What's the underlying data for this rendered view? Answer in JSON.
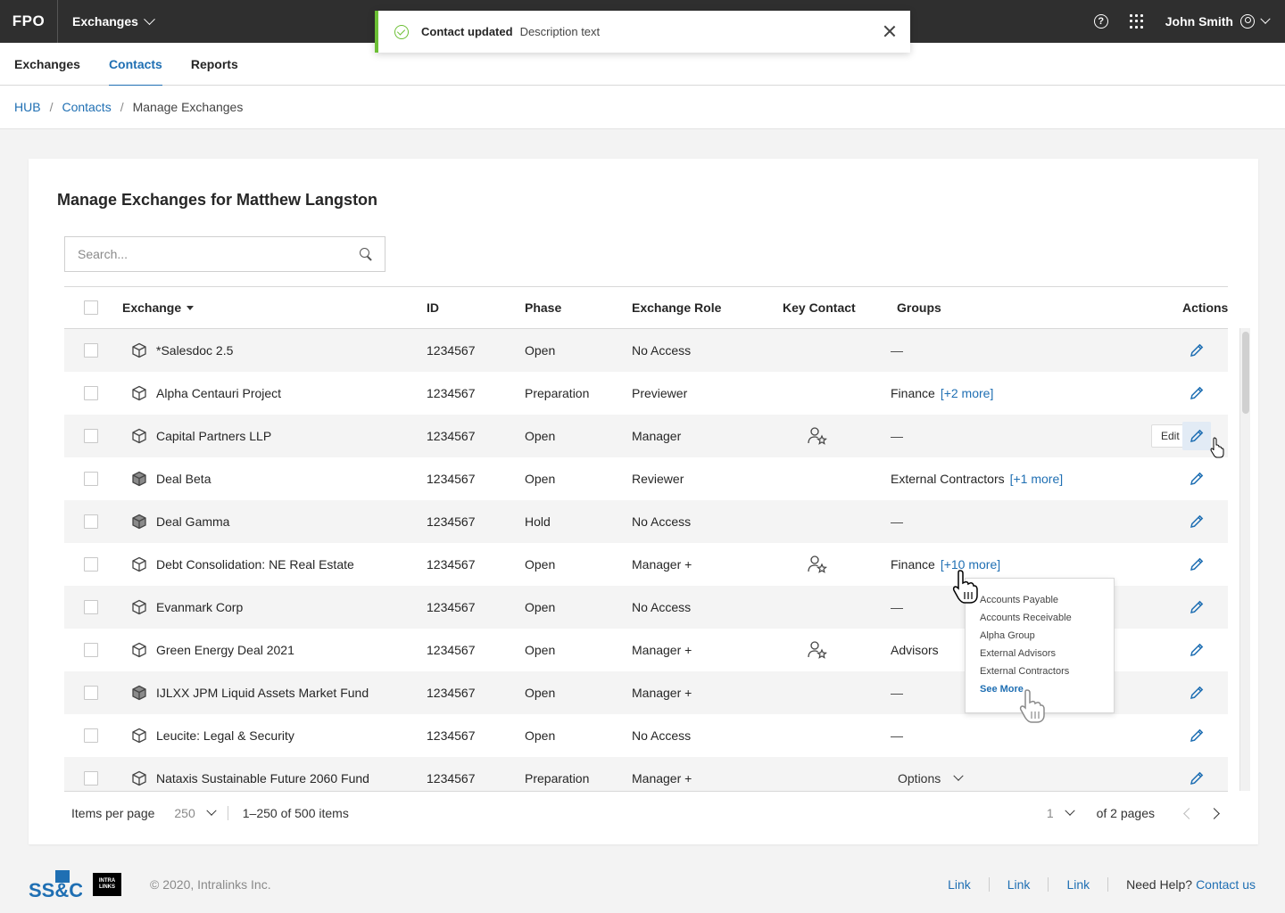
{
  "header": {
    "logo": "FPO",
    "app_switch": "Exchanges",
    "user_name": "John Smith",
    "help_glyph": "?"
  },
  "tabs": [
    {
      "label": "Exchanges",
      "active": false
    },
    {
      "label": "Contacts",
      "active": true
    },
    {
      "label": "Reports",
      "active": false
    }
  ],
  "breadcrumb": {
    "items": [
      "HUB",
      "Contacts"
    ],
    "current": "Manage Exchanges",
    "separator": "/"
  },
  "toast": {
    "title": "Contact updated",
    "description": "Description text",
    "status_color": "#6cbf35"
  },
  "page": {
    "title": "Manage Exchanges for Matthew Langston",
    "search_placeholder": "Search..."
  },
  "table": {
    "columns": {
      "exchange": "Exchange",
      "id": "ID",
      "phase": "Phase",
      "role": "Exchange Role",
      "key_contact": "Key Contact",
      "groups": "Groups",
      "actions": "Actions"
    },
    "rows": [
      {
        "name": "*Salesdoc 2.5",
        "icon": "box-outline-icon",
        "id": "1234567",
        "phase": "Open",
        "role": "No Access",
        "key_contact": false,
        "group": "—",
        "more": ""
      },
      {
        "name": "Alpha Centauri Project",
        "icon": "box-outline-icon",
        "id": "1234567",
        "phase": "Preparation",
        "role": "Previewer",
        "key_contact": false,
        "group": "Finance",
        "more": "[+2 more]"
      },
      {
        "name": "Capital Partners LLP",
        "icon": "box-outline-icon",
        "id": "1234567",
        "phase": "Open",
        "role": "Manager",
        "key_contact": true,
        "group": "—",
        "more": ""
      },
      {
        "name": "Deal Beta",
        "icon": "box-filled-icon",
        "id": "1234567",
        "phase": "Open",
        "role": "Reviewer",
        "key_contact": false,
        "group": "External Contractors",
        "more": "[+1 more]"
      },
      {
        "name": "Deal Gamma",
        "icon": "box-filled-icon",
        "id": "1234567",
        "phase": "Hold",
        "role": "No Access",
        "key_contact": false,
        "group": "—",
        "more": ""
      },
      {
        "name": "Debt Consolidation: NE Real Estate",
        "icon": "box-outline-icon",
        "id": "1234567",
        "phase": "Open",
        "role": "Manager +",
        "key_contact": true,
        "group": "Finance",
        "more": "[+10 more]"
      },
      {
        "name": "Evanmark Corp",
        "icon": "box-outline-icon",
        "id": "1234567",
        "phase": "Open",
        "role": "No Access",
        "key_contact": false,
        "group": "—",
        "more": ""
      },
      {
        "name": "Green Energy Deal 2021",
        "icon": "box-outline-icon",
        "id": "1234567",
        "phase": "Open",
        "role": "Manager +",
        "key_contact": true,
        "group": "Advisors",
        "more": ""
      },
      {
        "name": "IJLXX JPM Liquid Assets Market Fund",
        "icon": "box-filled-icon",
        "id": "1234567",
        "phase": "Open",
        "role": "Manager +",
        "key_contact": false,
        "group": "—",
        "more": ""
      },
      {
        "name": "Leucite: Legal & Security",
        "icon": "box-outline-icon",
        "id": "1234567",
        "phase": "Open",
        "role": "No Access",
        "key_contact": false,
        "group": "—",
        "more": ""
      },
      {
        "name": "Nataxis Sustainable Future 2060 Fund",
        "icon": "box-outline-icon",
        "id": "1234567",
        "phase": "Preparation",
        "role": "Manager +",
        "key_contact": false,
        "group": "",
        "more": "",
        "options": "Options"
      }
    ],
    "edit_tooltip": "Edit"
  },
  "groups_popover": {
    "items": [
      "Accounts Payable",
      "Accounts Receivable",
      "Alpha Group",
      "External Advisors",
      "External Contractors"
    ],
    "see_more": "See More"
  },
  "pagination": {
    "items_per_page_label": "Items per page",
    "items_per_page": "250",
    "range": "1–250 of 500 items",
    "page": "1",
    "of_pages": "of 2 pages"
  },
  "footer": {
    "logo_text": "SS&C",
    "logo2_line1": "INTRA",
    "logo2_line2": "LINKS",
    "copyright": "© 2020, Intralinks Inc.",
    "links": [
      "Link",
      "Link",
      "Link"
    ],
    "need_help": "Need Help?",
    "contact": "Contact us"
  },
  "colors": {
    "accent": "#1f6fb3",
    "topbar": "#2f2f2f",
    "success": "#6cbf35"
  }
}
